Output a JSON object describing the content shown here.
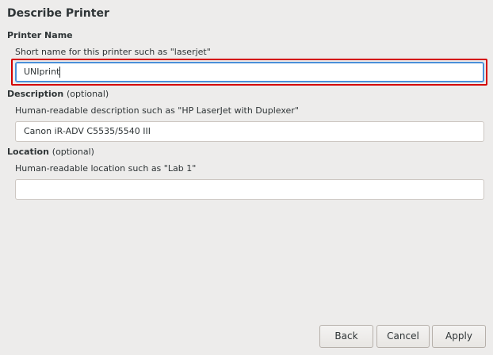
{
  "dialog": {
    "title": "Describe Printer"
  },
  "printer_name": {
    "label": "Printer Name",
    "hint": "Short name for this printer such as \"laserjet\"",
    "value": "UNIprint"
  },
  "description": {
    "label": "Description",
    "optional": "(optional)",
    "hint": "Human-readable description such as \"HP LaserJet with Duplexer\"",
    "value": "Canon iR-ADV C5535/5540 III"
  },
  "location": {
    "label": "Location",
    "optional": "(optional)",
    "hint": "Human-readable location such as \"Lab 1\"",
    "value": ""
  },
  "buttons": {
    "back": "Back",
    "cancel": "Cancel",
    "apply": "Apply"
  },
  "colors": {
    "focus_ring": "#4a90d9",
    "highlight": "#d40000"
  }
}
